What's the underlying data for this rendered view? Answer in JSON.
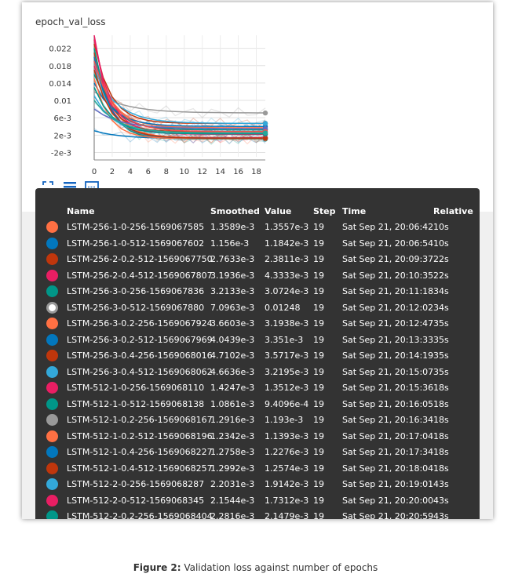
{
  "card": {
    "title": "epoch_val_loss"
  },
  "chart_data": {
    "type": "line",
    "title": "epoch_val_loss",
    "xlabel": "",
    "ylabel": "",
    "xlim": [
      0,
      19
    ],
    "ylim": [
      -0.003,
      0.025
    ],
    "x_ticks": [
      "0",
      "2",
      "4",
      "6",
      "8",
      "10",
      "12",
      "14",
      "16",
      "18"
    ],
    "y_ticks": [
      "0.022",
      "0.018",
      "0.014",
      "0.01",
      "6e-3",
      "2e-3",
      "-2e-3"
    ],
    "y_tick_values": [
      0.022,
      0.018,
      0.014,
      0.01,
      0.006,
      0.002,
      -0.002
    ],
    "grid": true,
    "series": [
      {
        "color": "#ff7043",
        "start": 0.024,
        "end": 0.0014,
        "rate": 0.55
      },
      {
        "color": "#0277bd",
        "start": 0.003,
        "end": 0.0012,
        "rate": 0.35
      },
      {
        "color": "#bf360c",
        "start": 0.021,
        "end": 0.0028,
        "rate": 0.6
      },
      {
        "color": "#e91e63",
        "start": 0.018,
        "end": 0.0032,
        "rate": 0.5
      },
      {
        "color": "#009688",
        "start": 0.016,
        "end": 0.0032,
        "rate": 0.45
      },
      {
        "color": "#999999",
        "start": 0.012,
        "end": 0.0071,
        "rate": 0.3
      },
      {
        "color": "#ff7043",
        "start": 0.02,
        "end": 0.0037,
        "rate": 0.5
      },
      {
        "color": "#0277bd",
        "start": 0.014,
        "end": 0.004,
        "rate": 0.45
      },
      {
        "color": "#bf360c",
        "start": 0.023,
        "end": 0.0047,
        "rate": 0.55
      },
      {
        "color": "#33a8d9",
        "start": 0.017,
        "end": 0.0047,
        "rate": 0.4
      },
      {
        "color": "#e91e63",
        "start": 0.025,
        "end": 0.0014,
        "rate": 0.65
      },
      {
        "color": "#009688",
        "start": 0.022,
        "end": 0.0011,
        "rate": 0.6
      },
      {
        "color": "#999999",
        "start": 0.019,
        "end": 0.0013,
        "rate": 0.55
      },
      {
        "color": "#ff7043",
        "start": 0.015,
        "end": 0.0012,
        "rate": 0.6
      },
      {
        "color": "#0277bd",
        "start": 0.02,
        "end": 0.0013,
        "rate": 0.55
      },
      {
        "color": "#bf360c",
        "start": 0.017,
        "end": 0.0013,
        "rate": 0.5
      },
      {
        "color": "#33a8d9",
        "start": 0.011,
        "end": 0.0022,
        "rate": 0.45
      },
      {
        "color": "#e91e63",
        "start": 0.024,
        "end": 0.0022,
        "rate": 0.55
      },
      {
        "color": "#009688",
        "start": 0.013,
        "end": 0.0023,
        "rate": 0.5
      },
      {
        "color": "#5e6bc0",
        "start": 0.008,
        "end": 0.0035,
        "rate": 0.35
      },
      {
        "color": "#ef5350",
        "start": 0.019,
        "end": 0.0028,
        "rate": 0.45
      },
      {
        "color": "#26a69a",
        "start": 0.01,
        "end": 0.0025,
        "rate": 0.4
      }
    ]
  },
  "toolbar": {
    "icons": [
      "fit-domain-icon",
      "data-selection-icon",
      "zoom-rect-icon"
    ]
  },
  "table": {
    "headers": {
      "name": "Name",
      "smoothed": "Smoothed",
      "value": "Value",
      "step": "Step",
      "time": "Time",
      "relative": "Relative"
    },
    "rows": [
      {
        "color": "#ff7043",
        "name": "LSTM-256-1-0-256-1569067585",
        "smoothed": "1.3589e-3",
        "value": "1.3557e-3",
        "step": "19",
        "time": "Sat Sep 21, 20:06:42",
        "relative": "10s"
      },
      {
        "color": "#0277bd",
        "name": "LSTM-256-1-0-512-1569067602",
        "smoothed": "1.156e-3",
        "value": "1.1842e-3",
        "step": "19",
        "time": "Sat Sep 21, 20:06:54",
        "relative": "10s"
      },
      {
        "color": "#bf360c",
        "name": "LSTM-256-2-0.2-512-1569067750",
        "smoothed": "2.7633e-3",
        "value": "2.3811e-3",
        "step": "19",
        "time": "Sat Sep 21, 20:09:37",
        "relative": "22s"
      },
      {
        "color": "#e91e63",
        "name": "LSTM-256-2-0.4-512-1569067807",
        "smoothed": "3.1936e-3",
        "value": "4.3333e-3",
        "step": "19",
        "time": "Sat Sep 21, 20:10:35",
        "relative": "22s"
      },
      {
        "color": "#009688",
        "name": "LSTM-256-3-0-256-1569067836",
        "smoothed": "3.2133e-3",
        "value": "3.0724e-3",
        "step": "19",
        "time": "Sat Sep 21, 20:11:18",
        "relative": "34s"
      },
      {
        "color": "#999999",
        "name": "LSTM-256-3-0-512-1569067880",
        "smoothed": "7.0963e-3",
        "value": "0.01248",
        "step": "19",
        "time": "Sat Sep 21, 20:12:02",
        "relative": "34s",
        "ring": true
      },
      {
        "color": "#ff7043",
        "name": "LSTM-256-3-0.2-256-1569067924",
        "smoothed": "3.6603e-3",
        "value": "3.1938e-3",
        "step": "19",
        "time": "Sat Sep 21, 20:12:47",
        "relative": "35s"
      },
      {
        "color": "#0277bd",
        "name": "LSTM-256-3-0.2-512-1569067969",
        "smoothed": "4.0439e-3",
        "value": "3.351e-3",
        "step": "19",
        "time": "Sat Sep 21, 20:13:33",
        "relative": "35s"
      },
      {
        "color": "#bf360c",
        "name": "LSTM-256-3-0.4-256-1569068016",
        "smoothed": "4.7102e-3",
        "value": "3.5717e-3",
        "step": "19",
        "time": "Sat Sep 21, 20:14:19",
        "relative": "35s"
      },
      {
        "color": "#33a8d9",
        "name": "LSTM-256-3-0.4-512-1569068062",
        "smoothed": "4.6636e-3",
        "value": "3.2195e-3",
        "step": "19",
        "time": "Sat Sep 21, 20:15:07",
        "relative": "35s"
      },
      {
        "color": "#e91e63",
        "name": "LSTM-512-1-0-256-1569068110",
        "smoothed": "1.4247e-3",
        "value": "1.3512e-3",
        "step": "19",
        "time": "Sat Sep 21, 20:15:36",
        "relative": "18s"
      },
      {
        "color": "#009688",
        "name": "LSTM-512-1-0-512-1569068138",
        "smoothed": "1.0861e-3",
        "value": "9.4096e-4",
        "step": "19",
        "time": "Sat Sep 21, 20:16:05",
        "relative": "18s"
      },
      {
        "color": "#999999",
        "name": "LSTM-512-1-0.2-256-1569068167",
        "smoothed": "1.2916e-3",
        "value": "1.193e-3",
        "step": "19",
        "time": "Sat Sep 21, 20:16:34",
        "relative": "18s"
      },
      {
        "color": "#ff7043",
        "name": "LSTM-512-1-0.2-512-1569068196",
        "smoothed": "1.2342e-3",
        "value": "1.1393e-3",
        "step": "19",
        "time": "Sat Sep 21, 20:17:04",
        "relative": "18s"
      },
      {
        "color": "#0277bd",
        "name": "LSTM-512-1-0.4-256-1569068227",
        "smoothed": "1.2758e-3",
        "value": "1.2276e-3",
        "step": "19",
        "time": "Sat Sep 21, 20:17:34",
        "relative": "18s"
      },
      {
        "color": "#bf360c",
        "name": "LSTM-512-1-0.4-512-1569068257",
        "smoothed": "1.2992e-3",
        "value": "1.2574e-3",
        "step": "19",
        "time": "Sat Sep 21, 20:18:04",
        "relative": "18s"
      },
      {
        "color": "#33a8d9",
        "name": "LSTM-512-2-0-256-1569068287",
        "smoothed": "2.2031e-3",
        "value": "1.9142e-3",
        "step": "19",
        "time": "Sat Sep 21, 20:19:01",
        "relative": "43s"
      },
      {
        "color": "#e91e63",
        "name": "LSTM-512-2-0-512-1569068345",
        "smoothed": "2.1544e-3",
        "value": "1.7312e-3",
        "step": "19",
        "time": "Sat Sep 21, 20:20:00",
        "relative": "43s"
      },
      {
        "color": "#009688",
        "name": "LSTM-512-2-0.2-256-1569068404",
        "smoothed": "2.2816e-3",
        "value": "2.1479e-3",
        "step": "19",
        "time": "Sat Sep 21, 20:20:59",
        "relative": "43s"
      }
    ]
  },
  "caption": {
    "label": "Figure 2:",
    "text": " Validation loss against number of epochs"
  }
}
